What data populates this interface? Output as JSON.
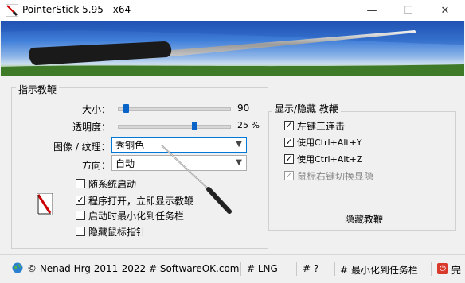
{
  "window": {
    "title": "PointerStick 5.95 - x64",
    "minimize": "—",
    "maximize": "☐",
    "close": "✕"
  },
  "group_main": {
    "title": "指示教鞭",
    "size_label": "大小：",
    "size_value": "90",
    "size_level": 0.05,
    "opacity_label": "透明度：",
    "opacity_value": "25 %",
    "opacity_level": 0.7,
    "image_label": "图像 / 纹理：",
    "image_value": "秀铜色",
    "direction_label": "方向：",
    "direction_value": "自动",
    "checkboxes": [
      {
        "label": "随系统启动",
        "checked": false
      },
      {
        "label": "程序打开，立即显示教鞭",
        "checked": true
      },
      {
        "label": "启动时最小化到任务栏",
        "checked": false
      },
      {
        "label": "隐藏鼠标指针",
        "checked": false
      }
    ]
  },
  "group_toggle": {
    "title": "显示/隐藏 教鞭",
    "checkboxes": [
      {
        "label": "左键三连击",
        "checked": true,
        "disabled": false
      },
      {
        "label": "使用Ctrl+Alt+Y",
        "checked": true,
        "disabled": false
      },
      {
        "label": "使用Ctrl+Alt+Z",
        "checked": true,
        "disabled": false
      },
      {
        "label": "鼠标右键切换显隐",
        "checked": true,
        "disabled": true
      }
    ],
    "hide_button": "隐藏教鞭"
  },
  "statusbar": {
    "copyright": "© Nenad Hrg 2011-2022 # SoftwareOK.com",
    "lng": "# LNG",
    "help": "# ?",
    "minimize_tray": "# 最小化到任务栏",
    "exit_prefix": "完"
  },
  "colors": {
    "accent": "#0078d7",
    "slider_thumb": "#0a64c8"
  }
}
